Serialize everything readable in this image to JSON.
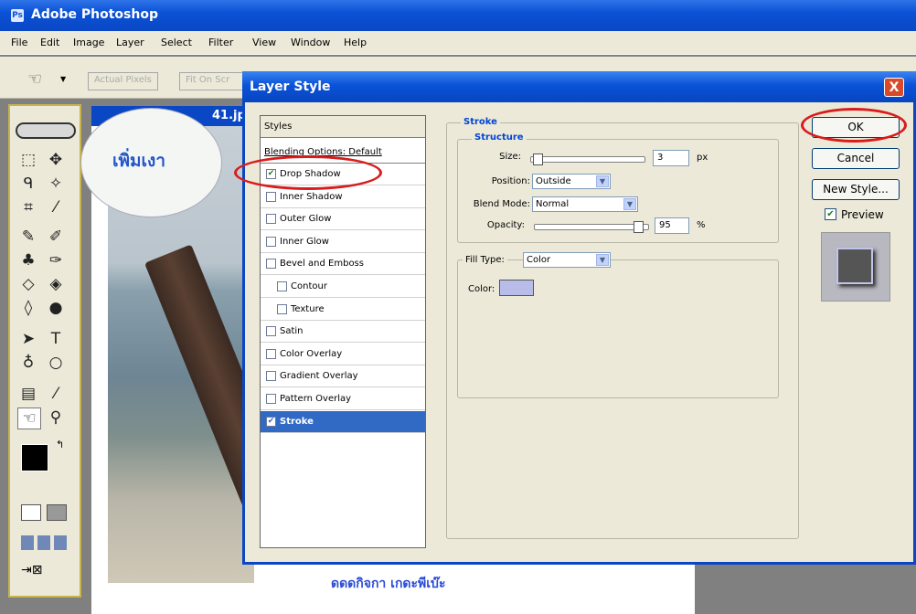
{
  "app": {
    "title": "Adobe Photoshop",
    "logo_text": "Ps"
  },
  "menu": [
    "File",
    "Edit",
    "Image",
    "Layer",
    "Select",
    "Filter",
    "View",
    "Window",
    "Help"
  ],
  "options_bar": {
    "actual_pixels": "Actual Pixels",
    "fit_on_screen": "Fit On Scr"
  },
  "document": {
    "title_fragment": "41.jp",
    "footer_text": "ดดดกิจกา เกดะพีเบ๊ะ"
  },
  "bubble": {
    "text": "เพิ่มเงา"
  },
  "dialog": {
    "title": "Layer Style",
    "close": "X",
    "styles_header": "Styles",
    "blending_options": "Blending Options: Default",
    "styles": [
      {
        "label": "Drop Shadow",
        "checked": true,
        "selected": false
      },
      {
        "label": "Inner Shadow",
        "checked": false,
        "selected": false
      },
      {
        "label": "Outer Glow",
        "checked": false,
        "selected": false
      },
      {
        "label": "Inner Glow",
        "checked": false,
        "selected": false
      },
      {
        "label": "Bevel and Emboss",
        "checked": false,
        "selected": false
      },
      {
        "label": "Contour",
        "checked": false,
        "selected": false
      },
      {
        "label": "Texture",
        "checked": false,
        "selected": false
      },
      {
        "label": "Satin",
        "checked": false,
        "selected": false
      },
      {
        "label": "Color Overlay",
        "checked": false,
        "selected": false
      },
      {
        "label": "Gradient Overlay",
        "checked": false,
        "selected": false
      },
      {
        "label": "Pattern Overlay",
        "checked": false,
        "selected": false
      },
      {
        "label": "Stroke",
        "checked": true,
        "selected": true
      }
    ],
    "stroke": {
      "section_title": "Stroke",
      "structure_title": "Structure",
      "size_label": "Size:",
      "size_value": "3",
      "size_unit": "px",
      "size_fraction": 0.02,
      "position_label": "Position:",
      "position_value": "Outside",
      "blend_mode_label": "Blend Mode:",
      "blend_mode_value": "Normal",
      "opacity_label": "Opacity:",
      "opacity_value": "95",
      "opacity_unit": "%",
      "opacity_fraction": 0.95,
      "fill_type_label": "Fill Type:",
      "fill_type_value": "Color",
      "color_label": "Color:",
      "color_value": "#b7bde8"
    },
    "buttons": {
      "ok": "OK",
      "cancel": "Cancel",
      "new_style": "New Style...",
      "preview": "Preview"
    },
    "preview_checked": true
  }
}
